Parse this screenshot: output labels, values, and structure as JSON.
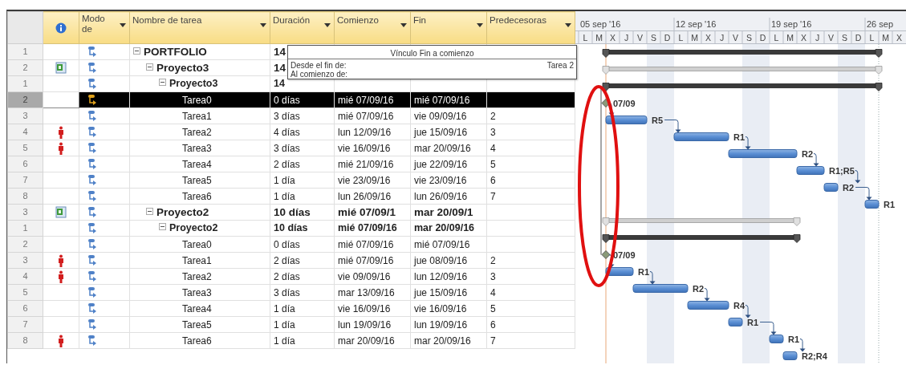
{
  "columns": [
    {
      "label": "Modo de"
    },
    {
      "label": "Nombre de tarea"
    },
    {
      "label": "Duración"
    },
    {
      "label": "Comienzo"
    },
    {
      "label": "Fin"
    },
    {
      "label": "Predecesoras"
    }
  ],
  "tooltip": {
    "title": "Vínculo Fin a comienzo",
    "lines": [
      {
        "label": "Desde el fin de:",
        "value": "Tarea 2"
      },
      {
        "label": "Al comienzo de:"
      }
    ]
  },
  "timescale": {
    "weeks": [
      "05 sep '16",
      "12 sep '16",
      "19 sep '16",
      "26 sep"
    ],
    "days": [
      {
        "letter": "L",
        "nonworking": false
      },
      {
        "letter": "M",
        "nonworking": false
      },
      {
        "letter": "X",
        "nonworking": false
      },
      {
        "letter": "J",
        "nonworking": false
      },
      {
        "letter": "V",
        "nonworking": false
      },
      {
        "letter": "S",
        "nonworking": true
      },
      {
        "letter": "D",
        "nonworking": true
      },
      {
        "letter": "L",
        "nonworking": false
      },
      {
        "letter": "M",
        "nonworking": false
      },
      {
        "letter": "X",
        "nonworking": false
      },
      {
        "letter": "J",
        "nonworking": false
      },
      {
        "letter": "V",
        "nonworking": false
      },
      {
        "letter": "S",
        "nonworking": true
      },
      {
        "letter": "D",
        "nonworking": true
      },
      {
        "letter": "L",
        "nonworking": false
      },
      {
        "letter": "M",
        "nonworking": false
      },
      {
        "letter": "X",
        "nonworking": false
      },
      {
        "letter": "J",
        "nonworking": false
      },
      {
        "letter": "V",
        "nonworking": false
      },
      {
        "letter": "S",
        "nonworking": true
      },
      {
        "letter": "D",
        "nonworking": true
      },
      {
        "letter": "L",
        "nonworking": false
      },
      {
        "letter": "M",
        "nonworking": false
      },
      {
        "letter": "X",
        "nonworking": false
      }
    ]
  },
  "tasks": [
    {
      "id": "1",
      "name": "PORTFOLIO",
      "duration": "14",
      "expanded": true,
      "selected": false,
      "bar": {
        "kind": "summary"
      },
      "children": [
        {
          "id": "2",
          "indicator": {
            "kind": "project"
          },
          "name": "Proyecto3",
          "duration": "14",
          "expanded": true,
          "selected": false,
          "bar": {
            "kind": "external"
          },
          "children": [
            {
              "id": "1",
              "name": "Proyecto3",
              "duration": "14",
              "expanded": true,
              "selected": false,
              "bar": {
                "kind": "summary"
              },
              "children": [
                {
                  "id": "2",
                  "name": "Tarea0",
                  "duration": "0 días",
                  "start": "mié 07/09/16",
                  "finish": "mié 07/09/16",
                  "selected": true,
                  "bar": {
                    "kind": "milestone",
                    "label": "07/09"
                  }
                },
                {
                  "id": "3",
                  "name": "Tarea1",
                  "duration": "3 días",
                  "start": "mié 07/09/16",
                  "finish": "vie 09/09/16",
                  "predecessors": "2",
                  "selected": false,
                  "bar": {
                    "kind": "task",
                    "label": "R5"
                  }
                },
                {
                  "id": "4",
                  "indicator": {
                    "kind": "person"
                  },
                  "name": "Tarea2",
                  "duration": "4 días",
                  "start": "lun 12/09/16",
                  "finish": "jue 15/09/16",
                  "predecessors": "3",
                  "selected": false,
                  "bar": {
                    "kind": "task",
                    "label": "R1"
                  }
                },
                {
                  "id": "5",
                  "indicator": {
                    "kind": "person"
                  },
                  "name": "Tarea3",
                  "duration": "3 días",
                  "start": "vie 16/09/16",
                  "finish": "mar 20/09/16",
                  "predecessors": "4",
                  "selected": false,
                  "bar": {
                    "kind": "task",
                    "label": "R2"
                  }
                },
                {
                  "id": "6",
                  "name": "Tarea4",
                  "duration": "2 días",
                  "start": "mié 21/09/16",
                  "finish": "jue 22/09/16",
                  "predecessors": "5",
                  "selected": false,
                  "bar": {
                    "kind": "task",
                    "label": "R1;R5"
                  }
                },
                {
                  "id": "7",
                  "name": "Tarea5",
                  "duration": "1 día",
                  "start": "vie 23/09/16",
                  "finish": "vie 23/09/16",
                  "predecessors": "6",
                  "selected": false,
                  "bar": {
                    "kind": "task",
                    "label": "R2"
                  }
                },
                {
                  "id": "8",
                  "name": "Tarea6",
                  "duration": "1 día",
                  "start": "lun 26/09/16",
                  "finish": "lun 26/09/16",
                  "predecessors": "7",
                  "selected": false,
                  "bar": {
                    "kind": "task",
                    "label": "R1"
                  }
                }
              ]
            }
          ]
        },
        {
          "id": "3",
          "indicator": {
            "kind": "project"
          },
          "name": "Proyecto2",
          "duration": "10 días",
          "start": "mié 07/09/1",
          "finish": "mar 20/09/1",
          "expanded": true,
          "selected": false,
          "bar": {
            "kind": "external"
          },
          "children": [
            {
              "id": "1",
              "name": "Proyecto2",
              "duration": "10 días",
              "start": "mié 07/09/16",
              "finish": "mar 20/09/16",
              "expanded": true,
              "selected": false,
              "bar": {
                "kind": "summary"
              },
              "children": [
                {
                  "id": "2",
                  "name": "Tarea0",
                  "duration": "0 días",
                  "start": "mié 07/09/16",
                  "finish": "mié 07/09/16",
                  "selected": false,
                  "bar": {
                    "kind": "milestone",
                    "label": "07/09"
                  }
                },
                {
                  "id": "3",
                  "indicator": {
                    "kind": "person"
                  },
                  "name": "Tarea1",
                  "duration": "2 días",
                  "start": "mié 07/09/16",
                  "finish": "jue 08/09/16",
                  "predecessors": "2",
                  "selected": false,
                  "bar": {
                    "kind": "task",
                    "label": "R1"
                  }
                },
                {
                  "id": "4",
                  "indicator": {
                    "kind": "person"
                  },
                  "name": "Tarea2",
                  "duration": "2 días",
                  "start": "vie 09/09/16",
                  "finish": "lun 12/09/16",
                  "predecessors": "3",
                  "selected": false,
                  "bar": {
                    "kind": "task",
                    "label": "R2"
                  }
                },
                {
                  "id": "5",
                  "name": "Tarea3",
                  "duration": "3 días",
                  "start": "mar 13/09/16",
                  "finish": "jue 15/09/16",
                  "predecessors": "4",
                  "selected": false,
                  "bar": {
                    "kind": "task",
                    "label": "R4"
                  }
                },
                {
                  "id": "6",
                  "name": "Tarea4",
                  "duration": "1 día",
                  "start": "vie 16/09/16",
                  "finish": "vie 16/09/16",
                  "predecessors": "5",
                  "selected": false,
                  "bar": {
                    "kind": "task",
                    "label": "R1"
                  }
                },
                {
                  "id": "7",
                  "name": "Tarea5",
                  "duration": "1 día",
                  "start": "lun 19/09/16",
                  "finish": "lun 19/09/16",
                  "predecessors": "6",
                  "selected": false,
                  "bar": {
                    "kind": "task",
                    "label": "R1"
                  }
                },
                {
                  "id": "8",
                  "indicator": {
                    "kind": "person"
                  },
                  "name": "Tarea6",
                  "duration": "1 día",
                  "start": "mar 20/09/16",
                  "finish": "mar 20/09/16",
                  "predecessors": "7",
                  "selected": false,
                  "bar": {
                    "kind": "task",
                    "label": "R2;R4"
                  }
                }
              ]
            }
          ]
        }
      ]
    }
  ]
}
